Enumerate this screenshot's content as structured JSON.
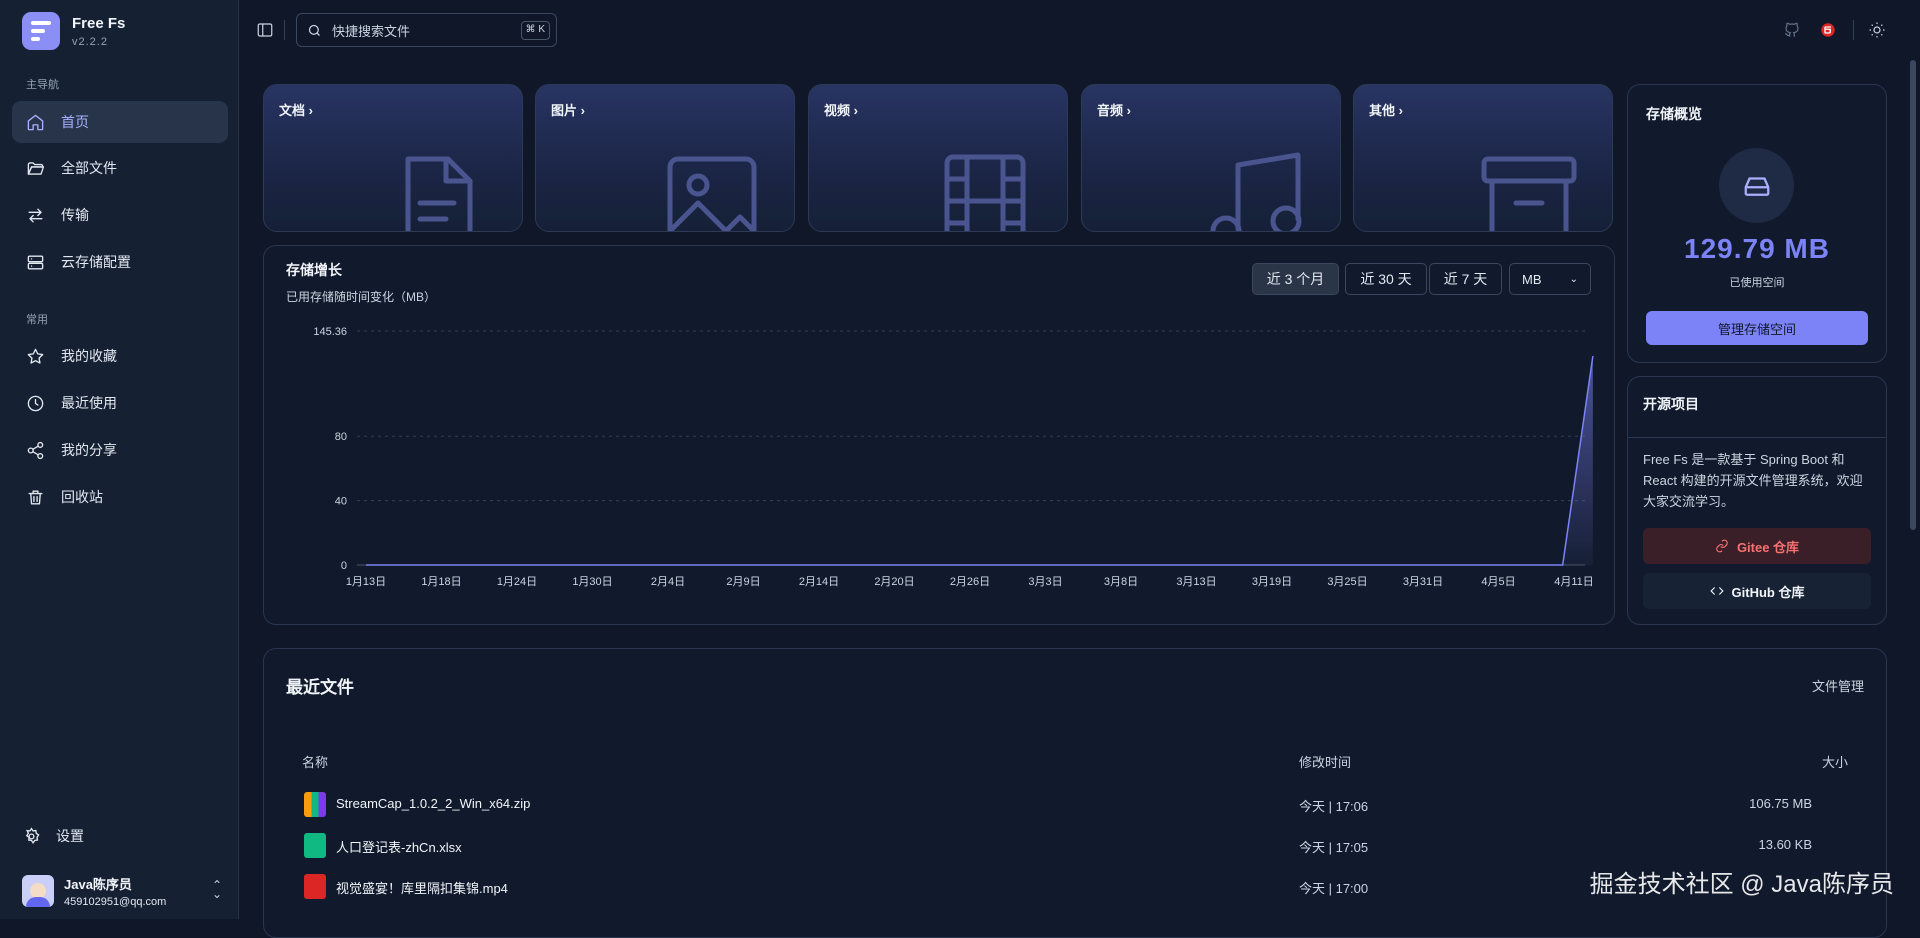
{
  "brand": {
    "name": "Free Fs",
    "version": "v2.2.2"
  },
  "nav": {
    "main_label": "主导航",
    "main": [
      "首页",
      "全部文件",
      "传输",
      "云存储配置"
    ],
    "common_label": "常用",
    "common": [
      "我的收藏",
      "最近使用",
      "我的分享",
      "回收站"
    ],
    "settings": "设置"
  },
  "user": {
    "name": "Java陈序员",
    "email": "459102951@qq.com"
  },
  "search": {
    "placeholder": "快捷搜索文件",
    "shortcut": "⌘ K"
  },
  "categories": [
    {
      "label": "文档",
      "icon": "document-icon"
    },
    {
      "label": "图片",
      "icon": "image-icon"
    },
    {
      "label": "视频",
      "icon": "film-icon"
    },
    {
      "label": "音频",
      "icon": "music-icon"
    },
    {
      "label": "其他",
      "icon": "archive-icon"
    }
  ],
  "chart_panel": {
    "title": "存储增长",
    "subtitle": "已用存储随时间变化（MB）",
    "ranges": [
      "近 3 个月",
      "近 30 天",
      "近 7 天"
    ],
    "active_range": "近 3 个月",
    "unit": "MB"
  },
  "chart_data": {
    "type": "area",
    "title": "存储增长",
    "ylabel": "",
    "xlabel": "",
    "ylim": [
      0,
      145.36
    ],
    "yticks": [
      0,
      40,
      80,
      145.36
    ],
    "x_ticks": [
      "1月13日",
      "1月18日",
      "1月24日",
      "1月30日",
      "2月4日",
      "2月9日",
      "2月14日",
      "2月20日",
      "2月26日",
      "3月3日",
      "3月8日",
      "3月13日",
      "3月19日",
      "3月25日",
      "3月31日",
      "4月5日",
      "4月11日"
    ],
    "series": [
      {
        "x_tick_index": [
          0,
          1,
          2,
          3,
          4,
          5,
          6,
          7,
          8,
          9,
          10,
          11,
          12,
          13,
          14,
          15,
          15.85,
          16.25
        ],
        "values": [
          0,
          0,
          0,
          0,
          0,
          0,
          0,
          0,
          0,
          0,
          0,
          0,
          0,
          0,
          0,
          0,
          0,
          129.79
        ]
      }
    ],
    "grid": true,
    "color": "#7c83f7"
  },
  "storage": {
    "title": "存储概览",
    "used": "129.79 MB",
    "used_label": "已使用空间",
    "manage": "管理存储空间"
  },
  "open_source": {
    "title": "开源项目",
    "desc": "Free Fs 是一款基于 Spring Boot 和 React 构建的开源文件管理系统，欢迎大家交流学习。",
    "gitee": "Gitee 仓库",
    "github": "GitHub 仓库"
  },
  "recent": {
    "title": "最近文件",
    "manage": "文件管理",
    "columns": [
      "名称",
      "修改时间",
      "大小"
    ],
    "files": [
      {
        "name": "StreamCap_1.0.2_2_Win_x64.zip",
        "time": "今天 | 17:06",
        "size": "106.75 MB",
        "color": "#f59e0b"
      },
      {
        "name": "人口登记表-zhCn.xlsx",
        "time": "今天 | 17:05",
        "size": "13.60 KB",
        "color": "#10b981"
      },
      {
        "name": "视觉盛宴！库里隔扣集锦.mp4",
        "time": "今天 | 17:00",
        "size": "",
        "color": "#dc2626"
      }
    ]
  },
  "watermark": "掘金技术社区 @ Java陈序员"
}
